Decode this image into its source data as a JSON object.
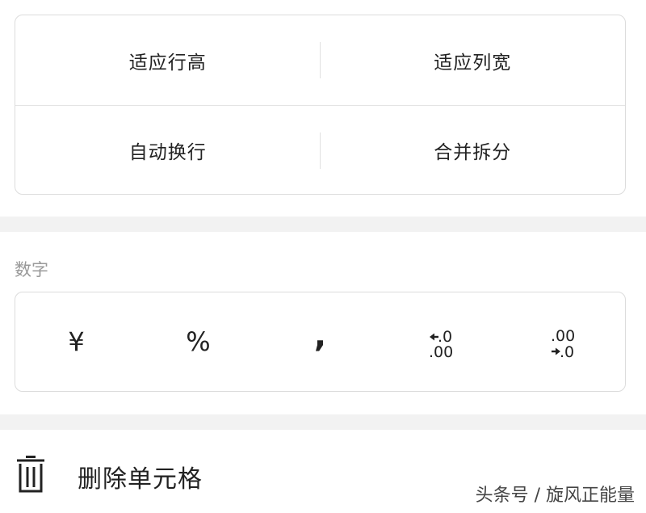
{
  "format": {
    "fit_row_height": "适应行高",
    "fit_column_width": "适应列宽",
    "wrap_text": "自动换行",
    "merge_split": "合并拆分"
  },
  "number": {
    "label": "数字",
    "currency": "¥",
    "percent": "%",
    "thousands": ",",
    "increase_decimal_top": ".0",
    "increase_decimal_bottom": ".00",
    "decrease_decimal_top": ".00",
    "decrease_decimal_bottom": ".0"
  },
  "delete": {
    "label": "删除单元格"
  },
  "watermark": "头条号 / 旋风正能量"
}
